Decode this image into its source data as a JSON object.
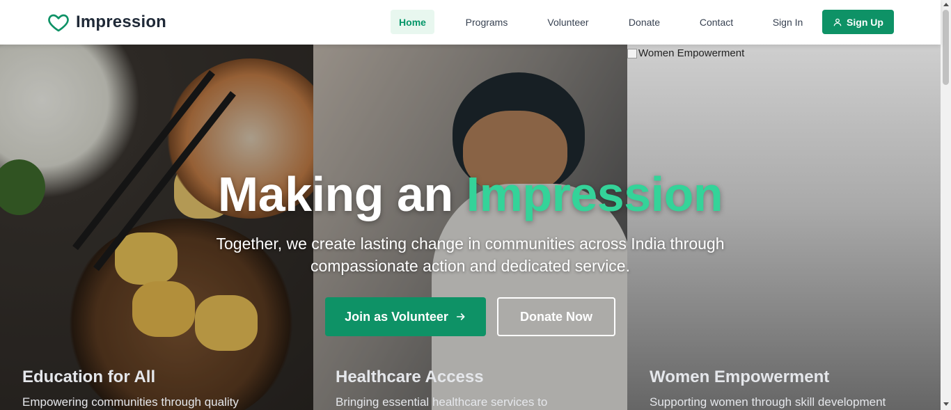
{
  "nav": {
    "brand": "Impression",
    "links": [
      {
        "label": "Home",
        "active": true
      },
      {
        "label": "Programs",
        "active": false
      },
      {
        "label": "Volunteer",
        "active": false
      },
      {
        "label": "Donate",
        "active": false
      },
      {
        "label": "Contact",
        "active": false
      },
      {
        "label": "Sign In",
        "active": false
      }
    ],
    "signup_label": "Sign Up"
  },
  "hero": {
    "headline_part1": "Making an ",
    "headline_highlight": "Impression",
    "subtitle": "Together, we create lasting change in communities across India through compassionate action and dedicated service.",
    "primary_button": "Join as Volunteer",
    "secondary_button": "Donate Now"
  },
  "programs": [
    {
      "title": "Education for All",
      "description": "Empowering communities through quality"
    },
    {
      "title": "Healthcare Access",
      "description": "Bringing essential healthcare services to"
    },
    {
      "title": "Women Empowerment",
      "description": "Supporting women through skill development",
      "broken_image_alt": "Women Empowerment"
    }
  ],
  "colors": {
    "accent": "#0e9266",
    "highlight": "#34d399",
    "active_bg": "#e8f7ef"
  }
}
